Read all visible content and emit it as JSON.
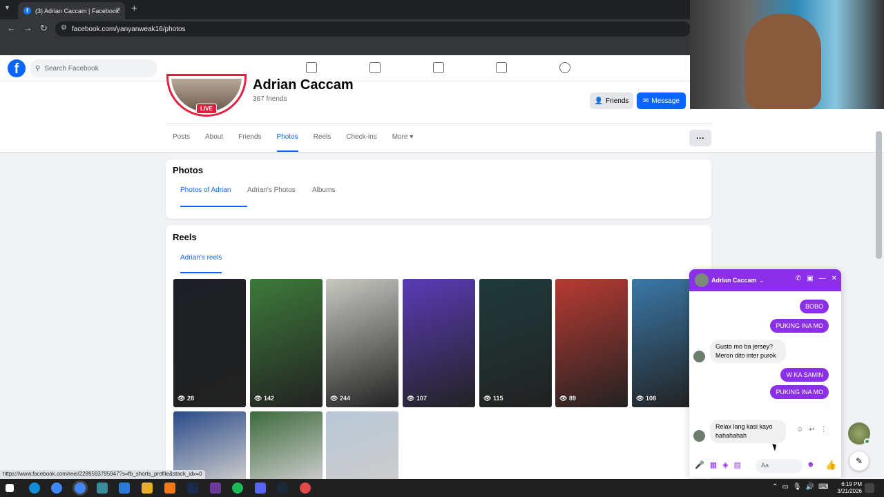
{
  "browser": {
    "tab_title": "(3) Adrian Caccam | Facebook",
    "url": "facebook.com/yanyanweak16/photos",
    "status_url": "https://www.facebook.com/reel/2289593795947?s=fb_shorts_profile&stack_idx=0"
  },
  "fb": {
    "search_placeholder": "Search Facebook",
    "nav_icons": [
      "home-icon",
      "feeds-icon",
      "video-icon",
      "marketplace-icon",
      "groups-icon"
    ]
  },
  "profile": {
    "name": "Adrian Caccam",
    "friends_count": "367 friends",
    "live_label": "LIVE",
    "friends_button": "Friends",
    "message_button": "Message",
    "tabs": [
      "Posts",
      "About",
      "Friends",
      "Photos",
      "Reels",
      "Check-ins",
      "More"
    ],
    "active_tab": "Photos"
  },
  "photos": {
    "title": "Photos",
    "subtabs": [
      "Photos of Adrian",
      "Adrian's Photos",
      "Albums"
    ]
  },
  "reels": {
    "title": "Reels",
    "subtab": "Adrian's reels",
    "items": [
      {
        "views": "28",
        "color": "#1c1f24"
      },
      {
        "views": "142",
        "color": "#3d7a3a"
      },
      {
        "views": "244",
        "color": "#c9c8c2"
      },
      {
        "views": "107",
        "color": "#5a3bb8"
      },
      {
        "views": "115",
        "color": "#1f3a3a"
      },
      {
        "views": "89",
        "color": "#b83a32"
      },
      {
        "views": "108",
        "color": "#3a78a8"
      }
    ],
    "second_row_colors": [
      "#2a4a8a",
      "#3c6a3a",
      "#b8c8d8"
    ]
  },
  "chat": {
    "name": "Adrian Caccam",
    "messages": [
      {
        "dir": "out",
        "text": "BOBO"
      },
      {
        "dir": "out",
        "text": "PUKING INA MO"
      },
      {
        "dir": "in",
        "text": "Gusto mo ba jersey? Meron dito inter purok"
      },
      {
        "dir": "out",
        "text": "W KA SAMIN"
      },
      {
        "dir": "out",
        "text": "PUKING INA MO"
      },
      {
        "dir": "in",
        "text": "Relax lang kasi kayo hahahahah"
      }
    ],
    "input_placeholder": "Aa"
  },
  "taskbar": {
    "time": "6:19 PM",
    "date": "3/21/2026"
  },
  "colors": {
    "fb_blue": "#0866ff",
    "messenger_purple": "#8b2fe8",
    "live_red": "#e41e3f"
  }
}
